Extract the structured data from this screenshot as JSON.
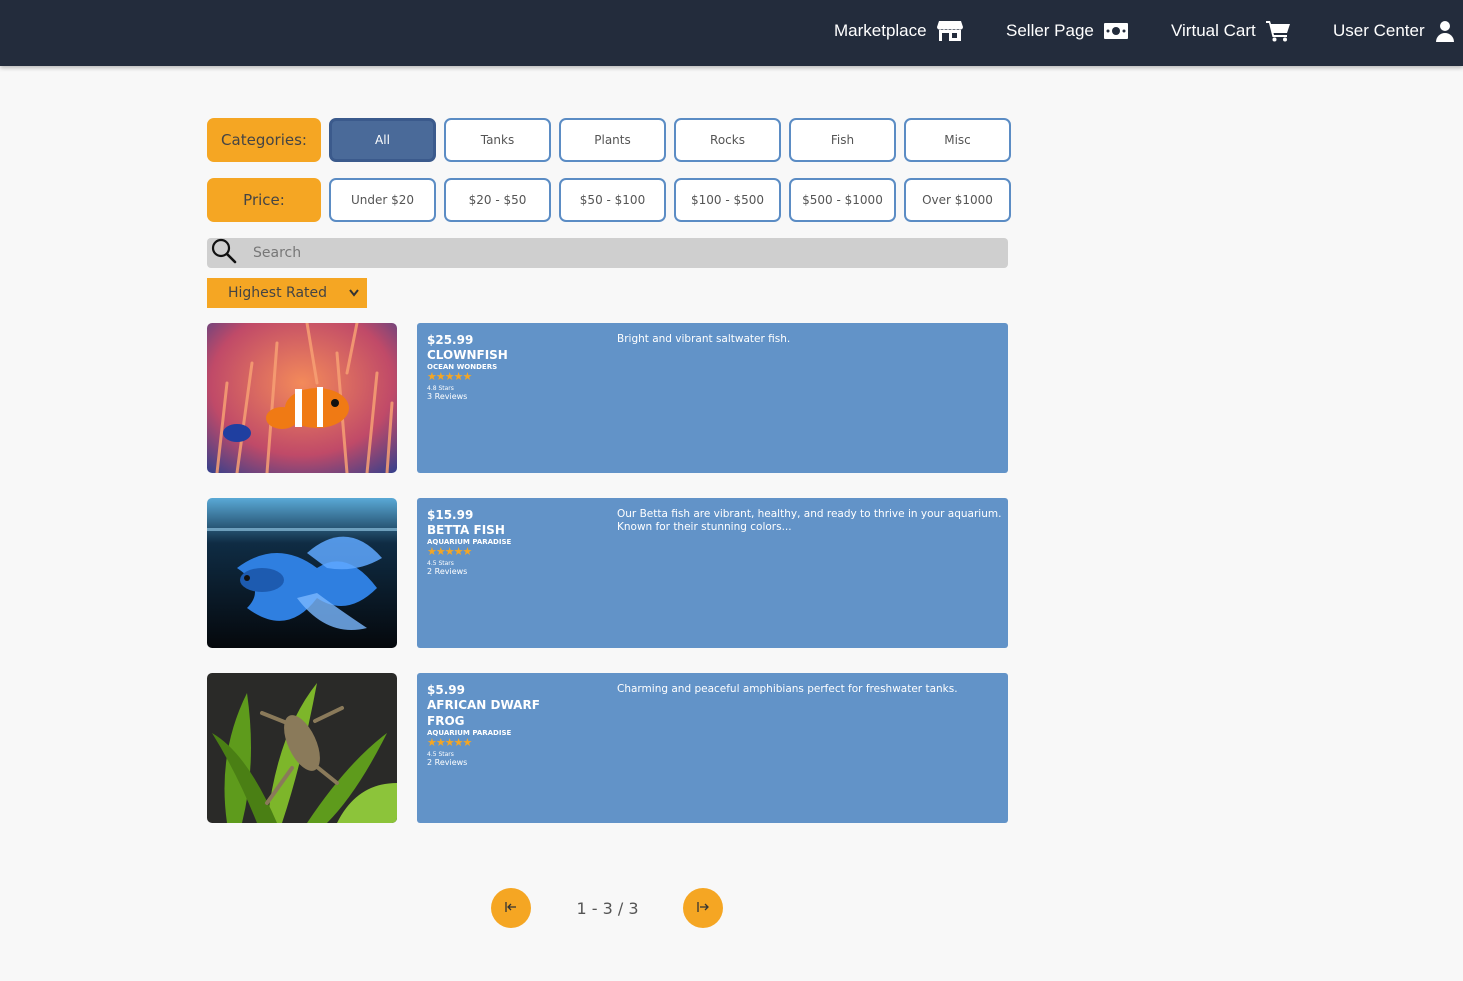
{
  "nav": {
    "marketplace": "Marketplace",
    "seller_page": "Seller Page",
    "virtual_cart": "Virtual Cart",
    "user_center": "User Center"
  },
  "filters": {
    "categories_label": "Categories:",
    "categories": [
      "All",
      "Tanks",
      "Plants",
      "Rocks",
      "Fish",
      "Misc"
    ],
    "active_category": "All",
    "price_label": "Price:",
    "prices": [
      "Under $20",
      "$20 - $50",
      "$50 - $100",
      "$100 - $500",
      "$500 - $1000",
      "Over $1000"
    ]
  },
  "search": {
    "placeholder": "Search"
  },
  "sort": {
    "selected": "Highest Rated"
  },
  "listings": [
    {
      "price": "$25.99",
      "name": "Clownfish",
      "seller": "Ocean Wonders",
      "stars": "★★★★★",
      "rating_text": "4.8 Stars",
      "reviews": "3 Reviews",
      "description": "Bright and vibrant saltwater fish."
    },
    {
      "price": "$15.99",
      "name": "Betta Fish",
      "seller": "Aquarium Paradise",
      "stars": "★★★★★",
      "rating_text": "4.5 Stars",
      "reviews": "2 Reviews",
      "description": "Our Betta fish are vibrant, healthy, and ready to thrive in your aquarium. Known for their stunning colors..."
    },
    {
      "price": "$5.99",
      "name": "African Dwarf Frog",
      "seller": "Aquarium Paradise",
      "stars": "★★★★★",
      "rating_text": "4.5 Stars",
      "reviews": "2 Reviews",
      "description": "Charming and peaceful amphibians perfect for freshwater tanks."
    }
  ],
  "pagination": {
    "label": "1 - 3 / 3",
    "prev_icon": "arrow-left-to-bar",
    "next_icon": "arrow-right-from-bar"
  },
  "colors": {
    "nav_bg": "#232c3c",
    "accent_orange": "#f5a623",
    "card_blue": "#6293c8",
    "active_blue": "#4a6a99"
  }
}
